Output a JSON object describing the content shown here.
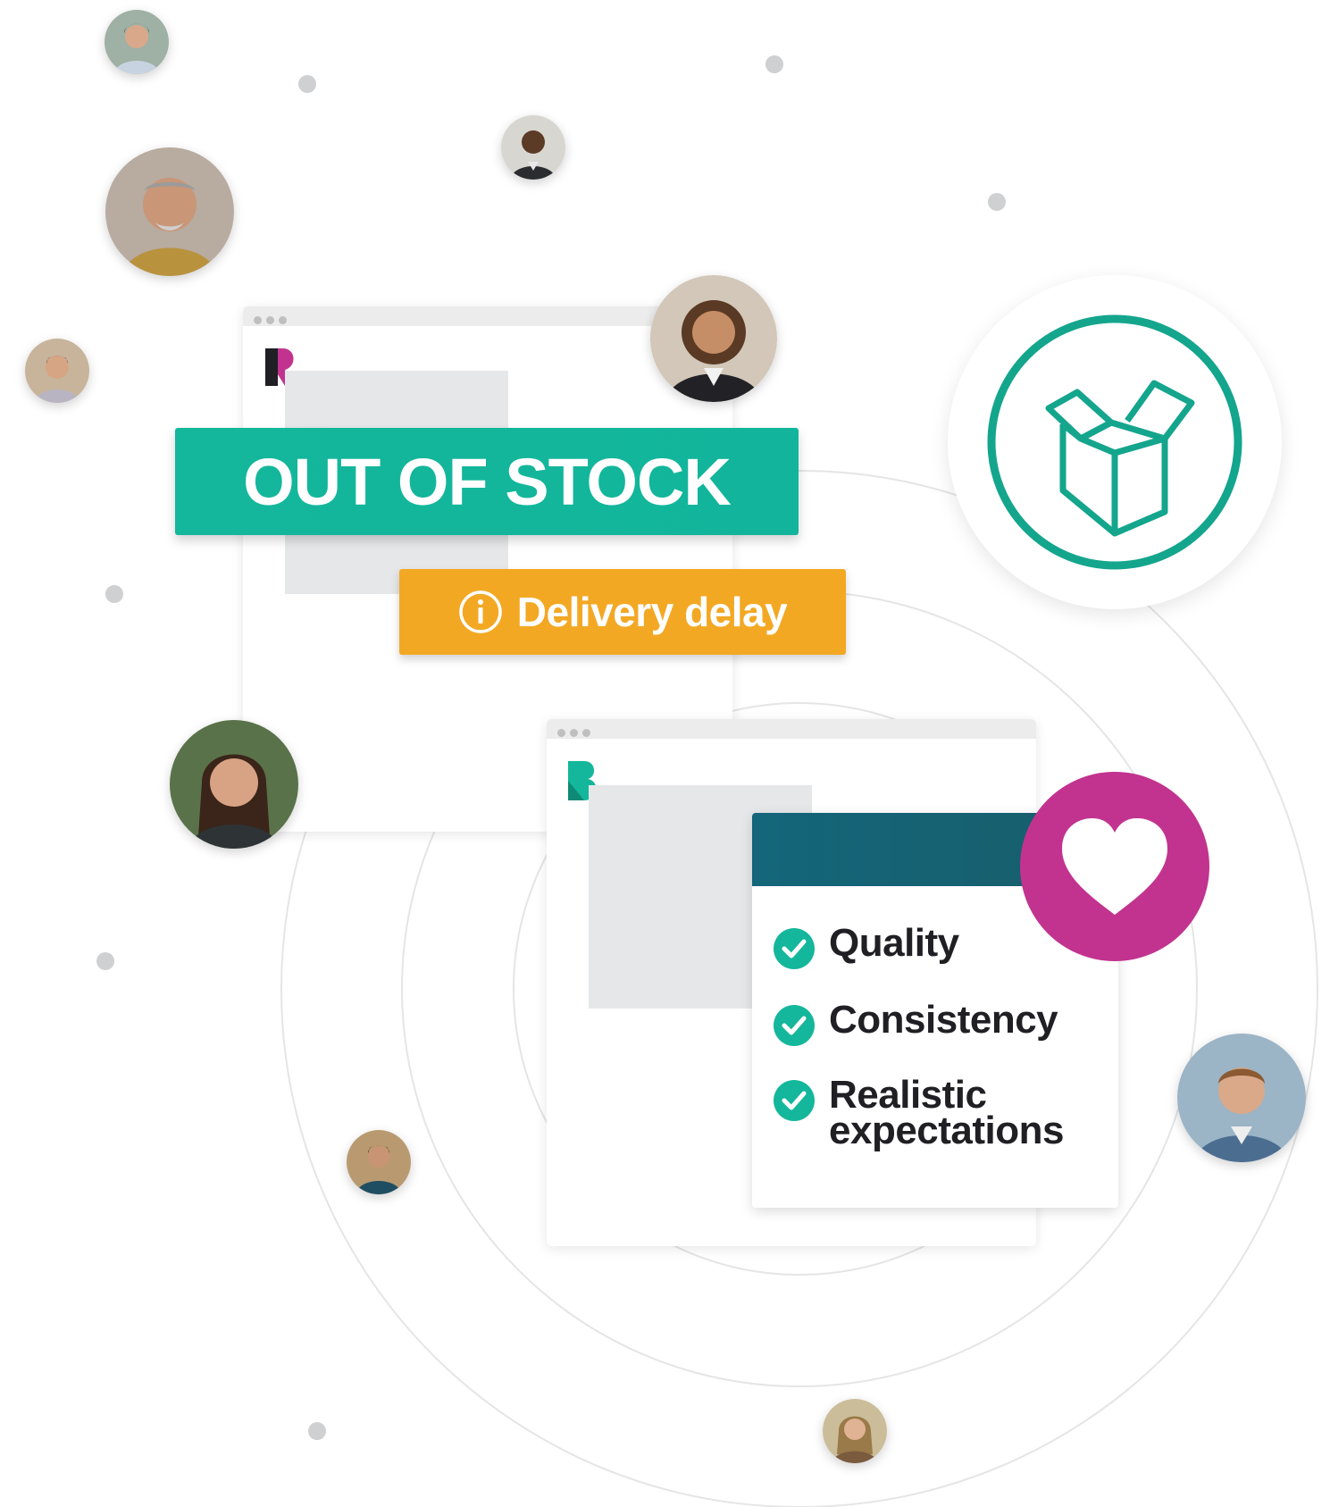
{
  "colors": {
    "accent_green": "#14b79b",
    "accent_orange": "#f3a824",
    "accent_magenta": "#c2338f",
    "card_header": "#14667a",
    "dark_text": "#1f1f24"
  },
  "banners": {
    "out_of_stock": "OUT OF STOCK",
    "delivery_delay": "Delivery delay",
    "delivery_icon": "info-icon"
  },
  "logos": {
    "brand_r": "R",
    "brand_b": "B"
  },
  "card": {
    "items": [
      {
        "label": "Quality",
        "icon": "check-icon"
      },
      {
        "label": "Consistency",
        "icon": "check-icon"
      },
      {
        "label": "Realistic",
        "label_line2": "expectations",
        "icon": "check-icon"
      }
    ],
    "badge_icon": "heart-icon"
  },
  "box_badge_icon": "open-box-icon"
}
